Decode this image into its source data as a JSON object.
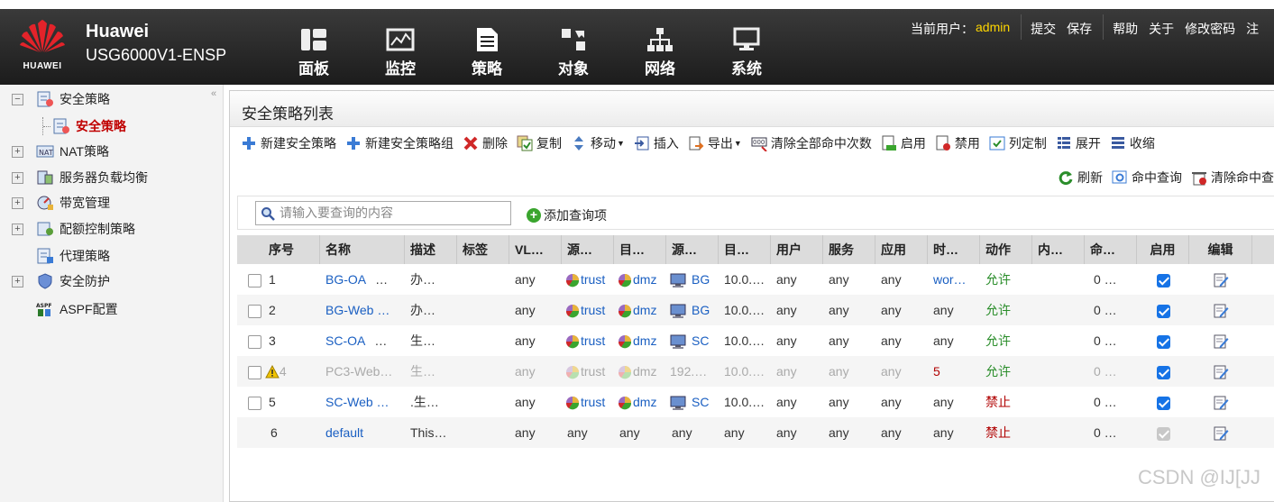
{
  "header": {
    "logo_text": "HUAWEI",
    "brand_name": "Huawei",
    "device_model": "USG6000V1-ENSP",
    "nav": [
      {
        "label": "面板",
        "icon": "dashboard-icon"
      },
      {
        "label": "监控",
        "icon": "monitor-chart-icon"
      },
      {
        "label": "策略",
        "icon": "policy-document-icon"
      },
      {
        "label": "对象",
        "icon": "object-icon"
      },
      {
        "label": "网络",
        "icon": "network-icon"
      },
      {
        "label": "系统",
        "icon": "system-icon"
      }
    ],
    "user_label": "当前用户：",
    "user_name": "admin",
    "links": [
      "提交",
      "保存",
      "帮助",
      "关于",
      "修改密码",
      "注"
    ]
  },
  "sidebar": {
    "items": [
      {
        "label": "安全策略",
        "expanded": true,
        "icon": "security-policy-icon"
      },
      {
        "label": "安全策略",
        "selected": true,
        "icon": "security-policy-icon"
      },
      {
        "label": "NAT策略",
        "icon": "nat-icon"
      },
      {
        "label": "服务器负载均衡",
        "icon": "server-lb-icon"
      },
      {
        "label": "带宽管理",
        "icon": "bandwidth-icon"
      },
      {
        "label": "配额控制策略",
        "icon": "quota-icon"
      },
      {
        "label": "代理策略",
        "icon": "proxy-icon"
      },
      {
        "label": "安全防护",
        "icon": "shield-icon"
      },
      {
        "label": "ASPF配置",
        "icon": "aspf-icon"
      }
    ]
  },
  "panel": {
    "title": "安全策略列表",
    "toolbar": [
      "新建安全策略",
      "新建安全策略组",
      "删除",
      "复制",
      "移动",
      "插入",
      "导出",
      "清除全部命中次数",
      "启用",
      "禁用",
      "列定制",
      "展开",
      "收缩"
    ],
    "toolbar2": [
      "刷新",
      "命中查询",
      "清除命中查"
    ],
    "search_placeholder": "请输入要查询的内容",
    "add_query": "添加查询项"
  },
  "table": {
    "columns": [
      "序号",
      "名称",
      "描述",
      "标签",
      "VL…",
      "源…",
      "目…",
      "源…",
      "目…",
      "用户",
      "服务",
      "应用",
      "时…",
      "动作",
      "内…",
      "命…",
      "启用",
      "编辑"
    ],
    "rows": [
      {
        "seq": "1",
        "name": "BG-OA",
        "name_tail": "…",
        "desc": "办…",
        "tag": "",
        "vlan": "any",
        "src_zone": "trust",
        "dst_zone": "dmz",
        "src_addr": "BG",
        "dst_addr": "10.0.…",
        "user": "any",
        "service": "any",
        "app": "any",
        "time": "wor…",
        "action": "允许",
        "content": "",
        "hits": "0 …",
        "enabled": true,
        "disabled_row": false
      },
      {
        "seq": "2",
        "name": "BG-Web …",
        "name_tail": "",
        "desc": "办…",
        "tag": "",
        "vlan": "any",
        "src_zone": "trust",
        "dst_zone": "dmz",
        "src_addr": "BG",
        "dst_addr": "10.0.…",
        "user": "any",
        "service": "any",
        "app": "any",
        "time": "any",
        "action": "允许",
        "content": "",
        "hits": "0 …",
        "enabled": true,
        "disabled_row": false
      },
      {
        "seq": "3",
        "name": "SC-OA",
        "name_tail": "…",
        "desc": "生…",
        "tag": "",
        "vlan": "any",
        "src_zone": "trust",
        "dst_zone": "dmz",
        "src_addr": "SC",
        "dst_addr": "10.0.…",
        "user": "any",
        "service": "any",
        "app": "any",
        "time": "any",
        "action": "允许",
        "content": "",
        "hits": "0 …",
        "enabled": true,
        "disabled_row": false
      },
      {
        "seq": "4",
        "name": "PC3-Web…",
        "name_tail": "",
        "desc": "生…",
        "tag": "",
        "vlan": "any",
        "src_zone": "trust",
        "dst_zone": "dmz",
        "src_addr": "192.…",
        "dst_addr": "10.0.…",
        "user": "any",
        "service": "any",
        "app": "any",
        "time": "5",
        "action": "允许",
        "content": "",
        "hits": "0 …",
        "enabled": true,
        "disabled_row": true
      },
      {
        "seq": "5",
        "name": "SC-Web …",
        "name_tail": "",
        "desc": ".生…",
        "tag": "",
        "vlan": "any",
        "src_zone": "trust",
        "dst_zone": "dmz",
        "src_addr": "SC",
        "dst_addr": "10.0.…",
        "user": "any",
        "service": "any",
        "app": "any",
        "time": "any",
        "action": "禁止",
        "content": "",
        "hits": "0 …",
        "enabled": true,
        "disabled_row": false
      },
      {
        "seq": "6",
        "name": "default",
        "name_tail": "",
        "desc": "This…",
        "tag": "",
        "vlan": "any",
        "src_zone": "any",
        "dst_zone": "any",
        "src_addr": "any",
        "dst_addr": "any",
        "user": "any",
        "service": "any",
        "app": "any",
        "time": "any",
        "action": "禁止",
        "content": "",
        "hits": "0 …",
        "enabled": true,
        "disabled_row": false
      }
    ]
  },
  "watermark": "CSDN @IJ[JJ",
  "colors": {
    "link": "#1a5fc2",
    "allow": "#2a8d2a",
    "deny": "#b00000",
    "selected_tree": "#c00000",
    "username": "#ffd700"
  }
}
